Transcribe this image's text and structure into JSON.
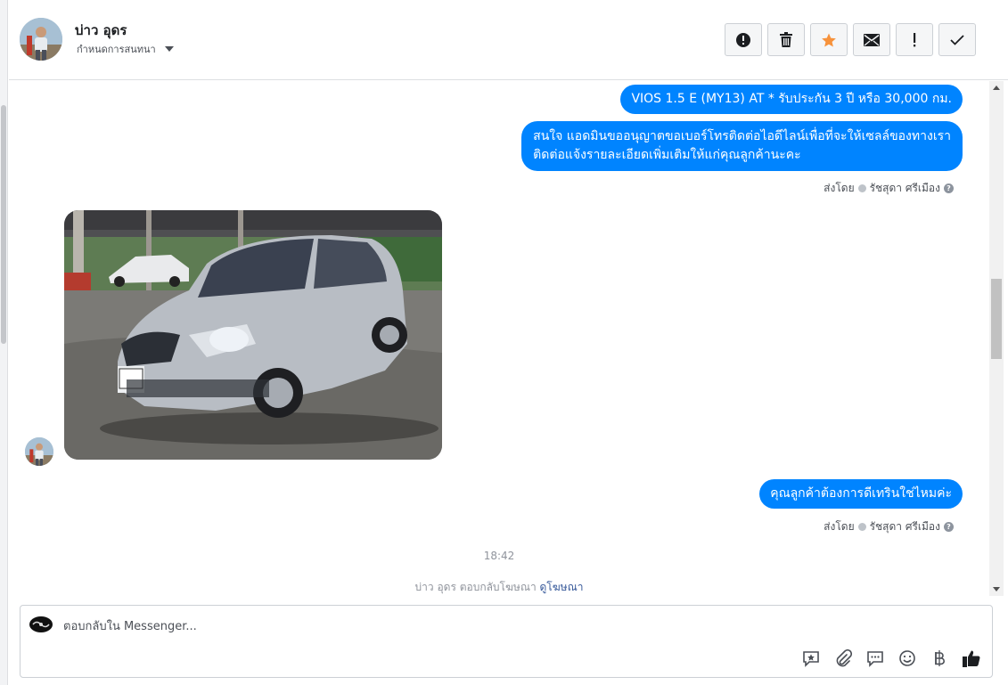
{
  "header": {
    "contact_name": "บ่าว อุดร",
    "assign_label": "กำหนดการสนทนา",
    "toolbar": [
      {
        "name": "spam-alert-button",
        "icon": "alert-circle-icon"
      },
      {
        "name": "delete-button",
        "icon": "trash-icon"
      },
      {
        "name": "star-button",
        "icon": "star-icon"
      },
      {
        "name": "mark-unread-button",
        "icon": "envelope-icon"
      },
      {
        "name": "important-button",
        "icon": "exclamation-icon"
      },
      {
        "name": "mark-done-button",
        "icon": "check-icon"
      }
    ]
  },
  "messages": {
    "outgoing_1": "VIOS 1.5 E (MY13) AT * รับประกัน 3 ปี หรือ 30,000 กม.",
    "outgoing_2_lines": [
      "สนใจ แอดมินขออนุญาตขอเบอร์โทรติดต่อไอดีไลน์เพื่อที่จะให้เซลล์ของทางเรา",
      "ติดต่อแจ้งรายละเอียดเพิ่มเติมให้แก่คุณลูกค้านะคะ"
    ],
    "sent_by_label": "ส่งโดย",
    "sender_name": "รัชสุดา ศรีเมือง",
    "incoming_photo": "silver-hatchback-car-photo",
    "outgoing_3": "คุณลูกค้าต้องการดีเทรินใช่ไหมค่ะ",
    "timestamp": "18:42",
    "reply_note": "บ่าว อุดร ตอบกลับโฆษณา",
    "reply_link": "ดูโฆษณา"
  },
  "composer": {
    "placeholder": "ตอบกลับใน Messenger...",
    "tools": [
      "saved-reply-icon",
      "attachment-icon",
      "chat-bubble-icon",
      "emoji-icon",
      "baht-icon",
      "thumbs-up-icon"
    ]
  },
  "colors": {
    "bubble_blue": "#0084ff",
    "star_orange": "#f7923b",
    "link": "#365899"
  }
}
